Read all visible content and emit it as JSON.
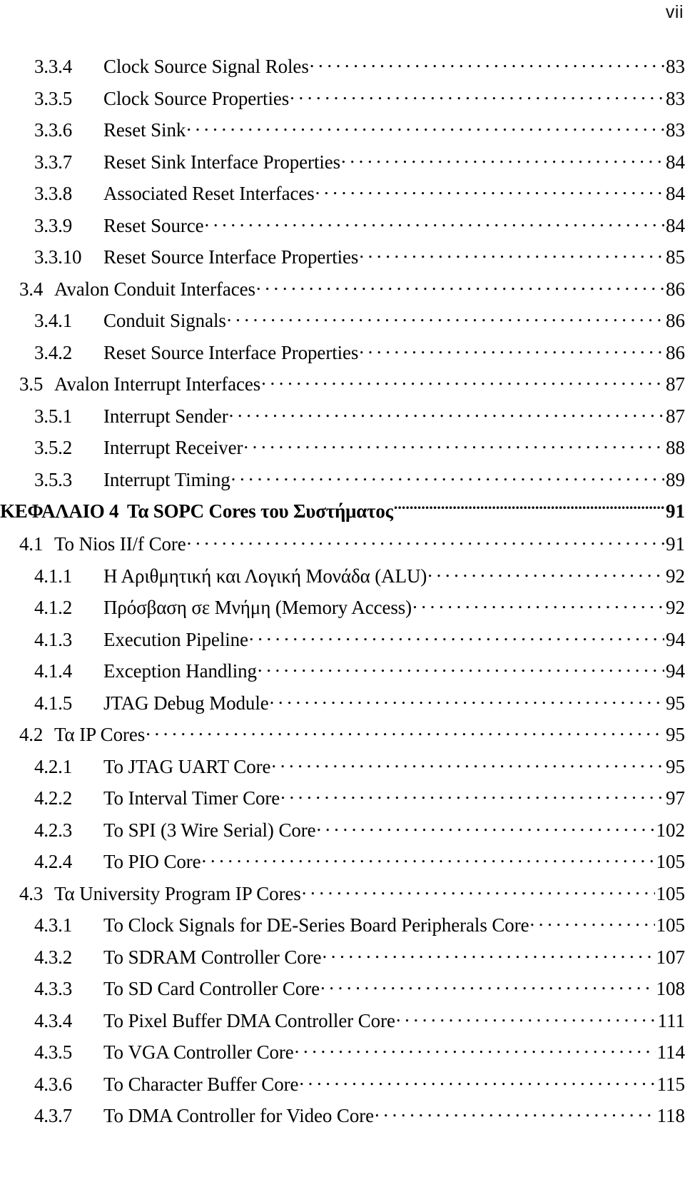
{
  "header": {
    "folio": "vii"
  },
  "toc": {
    "entries": [
      {
        "level": 3,
        "number": "3.3.4",
        "title": "Clock Source Signal Roles",
        "page": "83"
      },
      {
        "level": 3,
        "number": "3.3.5",
        "title": "Clock Source Properties",
        "page": "83"
      },
      {
        "level": 3,
        "number": "3.3.6",
        "title": "Reset Sink",
        "page": "83"
      },
      {
        "level": 3,
        "number": "3.3.7",
        "title": "Reset Sink Interface Properties",
        "page": "84"
      },
      {
        "level": 3,
        "number": "3.3.8",
        "title": "Associated Reset Interfaces",
        "page": "84"
      },
      {
        "level": 3,
        "number": "3.3.9",
        "title": "Reset Source",
        "page": "84"
      },
      {
        "level": 3,
        "number": "3.3.10",
        "title": "Reset Source Interface Properties",
        "page": "85"
      },
      {
        "level": 2,
        "number": "3.4",
        "title": "Avalon Conduit Interfaces",
        "page": "86"
      },
      {
        "level": 3,
        "number": "3.4.1",
        "title": "Conduit Signals",
        "page": "86"
      },
      {
        "level": 3,
        "number": "3.4.2",
        "title": "Reset Source Interface Properties",
        "page": "86"
      },
      {
        "level": 2,
        "number": "3.5",
        "title": "Avalon Interrupt Interfaces",
        "page": "87"
      },
      {
        "level": 3,
        "number": "3.5.1",
        "title": "Interrupt Sender",
        "page": "87"
      },
      {
        "level": 3,
        "number": "3.5.2",
        "title": "Interrupt Receiver",
        "page": "88"
      },
      {
        "level": 3,
        "number": "3.5.3",
        "title": "Interrupt Timing",
        "page": "89"
      },
      {
        "level": 1,
        "number": "ΚΕΦΑΛΑΙΟ 4",
        "title": "Τα SOPC Cores του Συστήματος",
        "page": "91"
      },
      {
        "level": 2,
        "number": "4.1",
        "title": "Το Nios II/f Core",
        "page": "91"
      },
      {
        "level": 3,
        "number": "4.1.1",
        "title": "Η Αριθμητική και Λογική Μονάδα (ALU)",
        "page": "92"
      },
      {
        "level": 3,
        "number": "4.1.2",
        "title": "Πρόσβαση σε Μνήμη (Memory Access)",
        "page": "92"
      },
      {
        "level": 3,
        "number": "4.1.3",
        "title": "Execution Pipeline",
        "page": "94"
      },
      {
        "level": 3,
        "number": "4.1.4",
        "title": "Exception Handling",
        "page": "94"
      },
      {
        "level": 3,
        "number": "4.1.5",
        "title": "JTAG Debug Module",
        "page": "95"
      },
      {
        "level": 2,
        "number": "4.2",
        "title": "Τα IP Cores",
        "page": "95"
      },
      {
        "level": 3,
        "number": "4.2.1",
        "title": "Το JTAG UART Core",
        "page": "95"
      },
      {
        "level": 3,
        "number": "4.2.2",
        "title": "Το Interval Timer Core",
        "page": "97"
      },
      {
        "level": 3,
        "number": "4.2.3",
        "title": "Το SPI (3 Wire Serial) Core",
        "page": "102"
      },
      {
        "level": 3,
        "number": "4.2.4",
        "title": "Το PIO Core",
        "page": "105"
      },
      {
        "level": 2,
        "number": "4.3",
        "title": "Τα University Program IP Cores",
        "page": "105"
      },
      {
        "level": 3,
        "number": "4.3.1",
        "title": "Το Clock Signals for DE-Series Board Peripherals Core",
        "page": "105"
      },
      {
        "level": 3,
        "number": "4.3.2",
        "title": "Το SDRAM Controller Core",
        "page": "107"
      },
      {
        "level": 3,
        "number": "4.3.3",
        "title": "Το SD Card Controller Core",
        "page": "108"
      },
      {
        "level": 3,
        "number": "4.3.4",
        "title": "Το Pixel Buffer DMA Controller Core",
        "page": "111"
      },
      {
        "level": 3,
        "number": "4.3.5",
        "title": "Το VGA Controller Core",
        "page": "114"
      },
      {
        "level": 3,
        "number": "4.3.6",
        "title": "Το Character Buffer Core",
        "page": "115"
      },
      {
        "level": 3,
        "number": "4.3.7",
        "title": "Το DMA Controller for Video Core",
        "page": "118"
      }
    ]
  }
}
